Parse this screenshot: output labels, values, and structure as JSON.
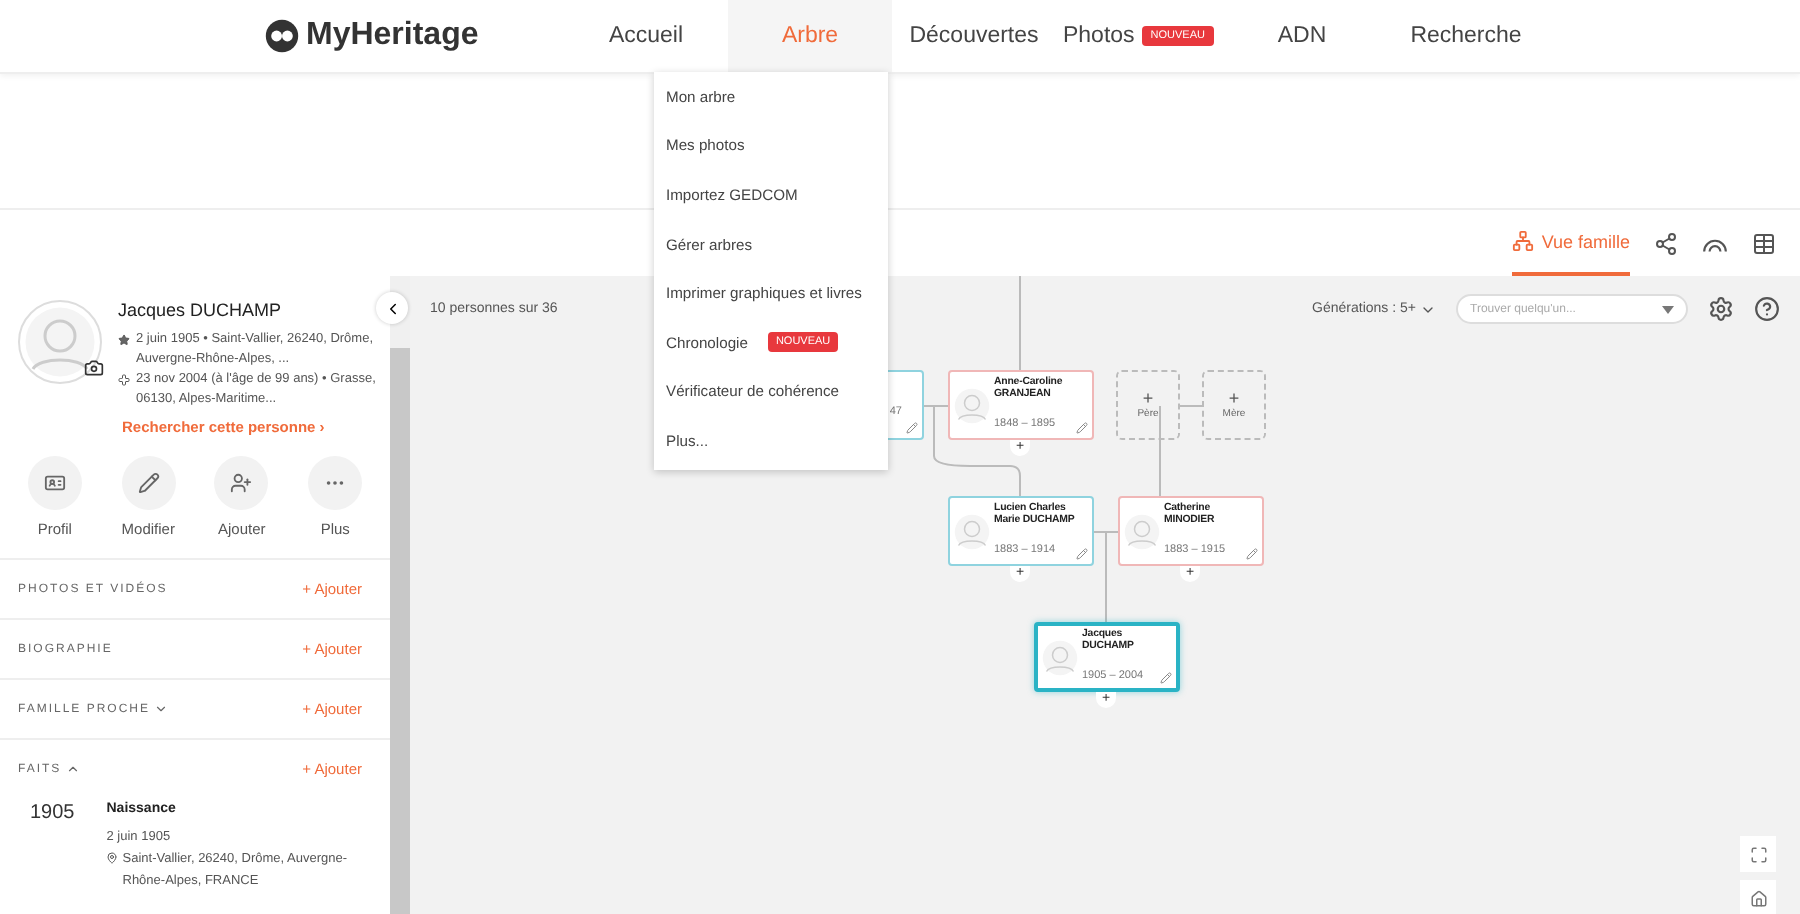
{
  "nav": {
    "logo": "MyHeritage",
    "items": [
      {
        "label": "Accueil",
        "selected": false
      },
      {
        "label": "Arbre",
        "selected": true
      },
      {
        "label": "Découvertes",
        "selected": false
      },
      {
        "label": "Photos",
        "selected": false,
        "badge": "NOUVEAU"
      },
      {
        "label": "ADN",
        "selected": false
      },
      {
        "label": "Recherche",
        "selected": false
      }
    ]
  },
  "dropdown": {
    "items": [
      {
        "label": "Mon arbre"
      },
      {
        "label": "Mes photos"
      },
      {
        "label": "Importez GEDCOM"
      },
      {
        "label": "Gérer arbres"
      },
      {
        "label": "Imprimer graphiques et livres"
      },
      {
        "label": "Chronologie",
        "badge": "NOUVEAU"
      },
      {
        "label": "Vérificateur de cohérence"
      },
      {
        "label": "Plus..."
      }
    ]
  },
  "view_tabs": {
    "label": "Vue famille"
  },
  "person": {
    "name": "Jacques DUCHAMP",
    "birth": "2 juin 1905 • Saint-Vallier, 26240, Drôme, Auvergne-Rhône-Alpes, ...",
    "death": "23 nov 2004 (à l'âge de 99 ans) • Grasse, 06130, Alpes-Maritime...",
    "search_link": "Rechercher cette personne ›",
    "actions": [
      {
        "kind": "profile",
        "label": "Profil"
      },
      {
        "kind": "edit",
        "label": "Modifier"
      },
      {
        "kind": "add",
        "label": "Ajouter"
      },
      {
        "kind": "more",
        "label": "Plus"
      }
    ],
    "sections": [
      {
        "title": "PHOTOS ET VIDÉOS",
        "add": "+ Ajouter"
      },
      {
        "title": "BIOGRAPHIE",
        "add": "+ Ajouter"
      },
      {
        "title": "FAMILLE PROCHE",
        "add": "+ Ajouter",
        "expanded": false
      },
      {
        "title": "FAITS",
        "add": "+ Ajouter",
        "expanded": true
      }
    ],
    "facts": [
      {
        "year": "1905",
        "title": "Naissance",
        "date": "2 juin 1905",
        "place": "Saint-Vallier, 26240, Drôme, Auvergne-Rhône-Alpes, FRANCE"
      }
    ]
  },
  "canvas": {
    "count": "10 personnes sur 36",
    "generations": "Générations : 5+",
    "search": {
      "placeholder": "Trouver quelqu'un..."
    },
    "nodes": [
      {
        "kind": "person",
        "color": "#8fd3df",
        "dates": "47",
        "selected": false
      },
      {
        "kind": "person",
        "color": "#f0b7b7",
        "name": "Anne-Caroline GRANJEAN",
        "dates": "1848 – 1895",
        "add": "+",
        "selected": false
      },
      {
        "kind": "empty",
        "add": "+",
        "label": "Père"
      },
      {
        "kind": "empty",
        "add": "+",
        "label": "Mère"
      },
      {
        "kind": "person",
        "color": "#8fd3df",
        "name": "Lucien Charles Marie DUCHAMP",
        "dates": "1883 – 1914",
        "add": "+",
        "selected": false
      },
      {
        "kind": "person",
        "color": "#f0b7b7",
        "name": "Catherine MINODIER",
        "dates": "1883 – 1915",
        "add": "+",
        "selected": false
      },
      {
        "kind": "person",
        "color": "#2ab3c5",
        "name": "Jacques DUCHAMP",
        "dates": "1905 – 2004",
        "add": "+",
        "selected": true
      }
    ]
  }
}
